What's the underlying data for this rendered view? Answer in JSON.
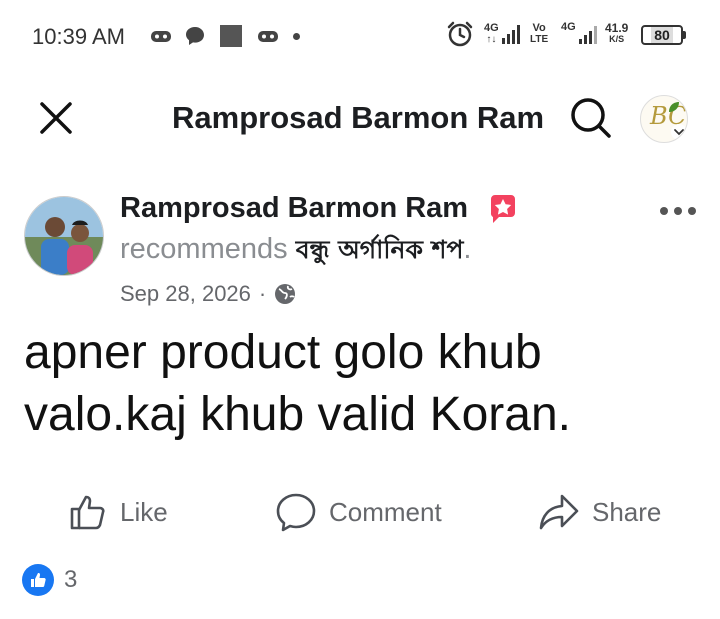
{
  "status_bar": {
    "time": "10:39 AM",
    "sim1_label": "4G",
    "sim1_sub": "↑↓",
    "volte_top": "Vo",
    "volte_bottom": "LTE",
    "sim2_label": "4G",
    "speed_value": "41.9",
    "speed_unit": "K/S",
    "battery_level": "80",
    "icons": [
      "gamepad-icon",
      "chat-bubble-icon",
      "square-icon",
      "gamepad-icon",
      "dot-icon",
      "alarm-icon"
    ]
  },
  "header": {
    "title": "Ramprosad Barmon Ram",
    "close_icon": "close-icon",
    "search_icon": "search-icon",
    "page_logo_text": "BC"
  },
  "post": {
    "author_name": "Ramprosad Barmon Ram",
    "badge_icon": "star-recommend-icon",
    "recommend_verb": "recommends",
    "recommended_page": "বন্ধু অর্গানিক শপ",
    "recommend_suffix": ".",
    "date": "Sep 28, 2026",
    "separator": "·",
    "audience_icon": "globe-icon",
    "text": "apner product golo khub valo.kaj khub valid Koran."
  },
  "actions": {
    "like_label": "Like",
    "comment_label": "Comment",
    "share_label": "Share"
  },
  "reactions": {
    "count": "3",
    "icon": "like-reaction-icon"
  },
  "colors": {
    "accent": "#1877f2",
    "badge": "#f3425f",
    "muted": "#65676b"
  }
}
